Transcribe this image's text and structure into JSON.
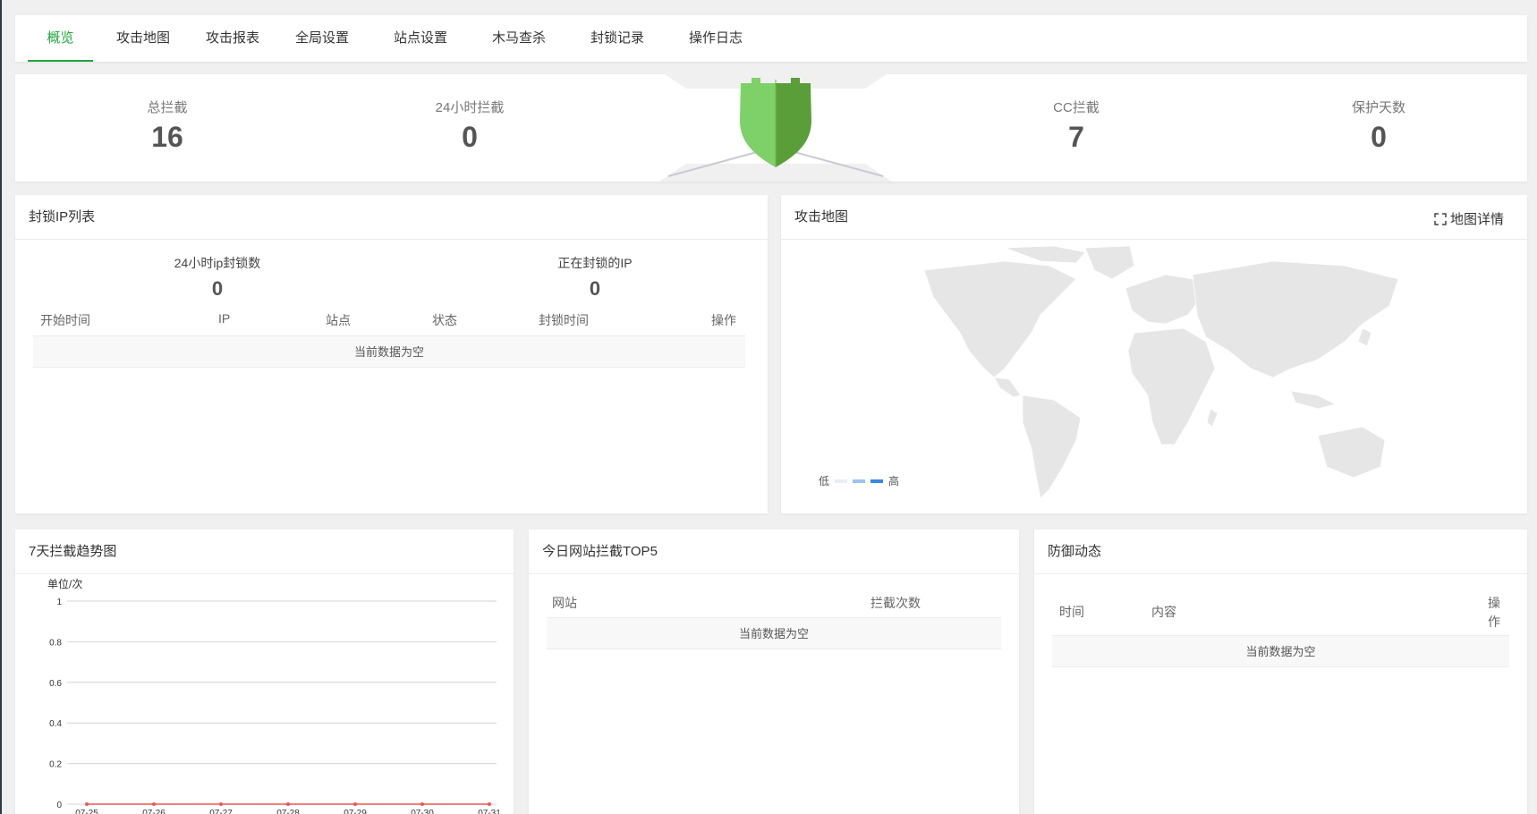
{
  "tabs": [
    {
      "label": "概览",
      "active": true
    },
    {
      "label": "攻击地图"
    },
    {
      "label": "攻击报表"
    },
    {
      "label": "全局设置"
    },
    {
      "label": "站点设置"
    },
    {
      "label": "木马查杀"
    },
    {
      "label": "封锁记录"
    },
    {
      "label": "操作日志"
    }
  ],
  "stats": {
    "total": {
      "label": "总拦截",
      "value": "16"
    },
    "day": {
      "label": "24小时拦截",
      "value": "0"
    },
    "cc": {
      "label": "CC拦截",
      "value": "7"
    },
    "days": {
      "label": "保护天数",
      "value": "0"
    }
  },
  "blocked_ip": {
    "title": "封锁IP列表",
    "count24": {
      "label": "24小时ip封锁数",
      "value": "0"
    },
    "active": {
      "label": "正在封锁的IP",
      "value": "0"
    },
    "columns": [
      "开始时间",
      "IP",
      "站点",
      "状态",
      "封锁时间",
      "操作"
    ],
    "empty": "当前数据为空"
  },
  "attack_map": {
    "title": "攻击地图",
    "detail_label": "地图详情",
    "legend_low": "低",
    "legend_high": "高",
    "legend_colors": [
      "#e6eef8",
      "#9cc3ee",
      "#3a86e0"
    ],
    "land_color": "#e6e6e6"
  },
  "trend": {
    "title": "7天拦截趋势图",
    "unit": "单位/次"
  },
  "chart_data": {
    "type": "line",
    "x": [
      "07-25",
      "07-26",
      "07-27",
      "07-28",
      "07-29",
      "07-30",
      "07-31"
    ],
    "series": [
      {
        "values": [
          0,
          0,
          0,
          0,
          0,
          0,
          0
        ],
        "color": "#ee5555"
      }
    ],
    "ylabel": "单位/次",
    "ylim": [
      0,
      1
    ],
    "yticks": [
      "0",
      "0.2",
      "0.4",
      "0.6",
      "0.8",
      "1"
    ],
    "grid": true
  },
  "top5": {
    "title": "今日网站拦截TOP5",
    "columns": [
      "网站",
      "拦截次数"
    ],
    "empty": "当前数据为空"
  },
  "defense": {
    "title": "防御动态",
    "columns": [
      "时间",
      "内容",
      "操",
      "作"
    ],
    "empty": "当前数据为空"
  },
  "colors": {
    "accent": "#20a53a",
    "shield_light": "#7ed069",
    "shield_dark": "#5a9e3a"
  }
}
